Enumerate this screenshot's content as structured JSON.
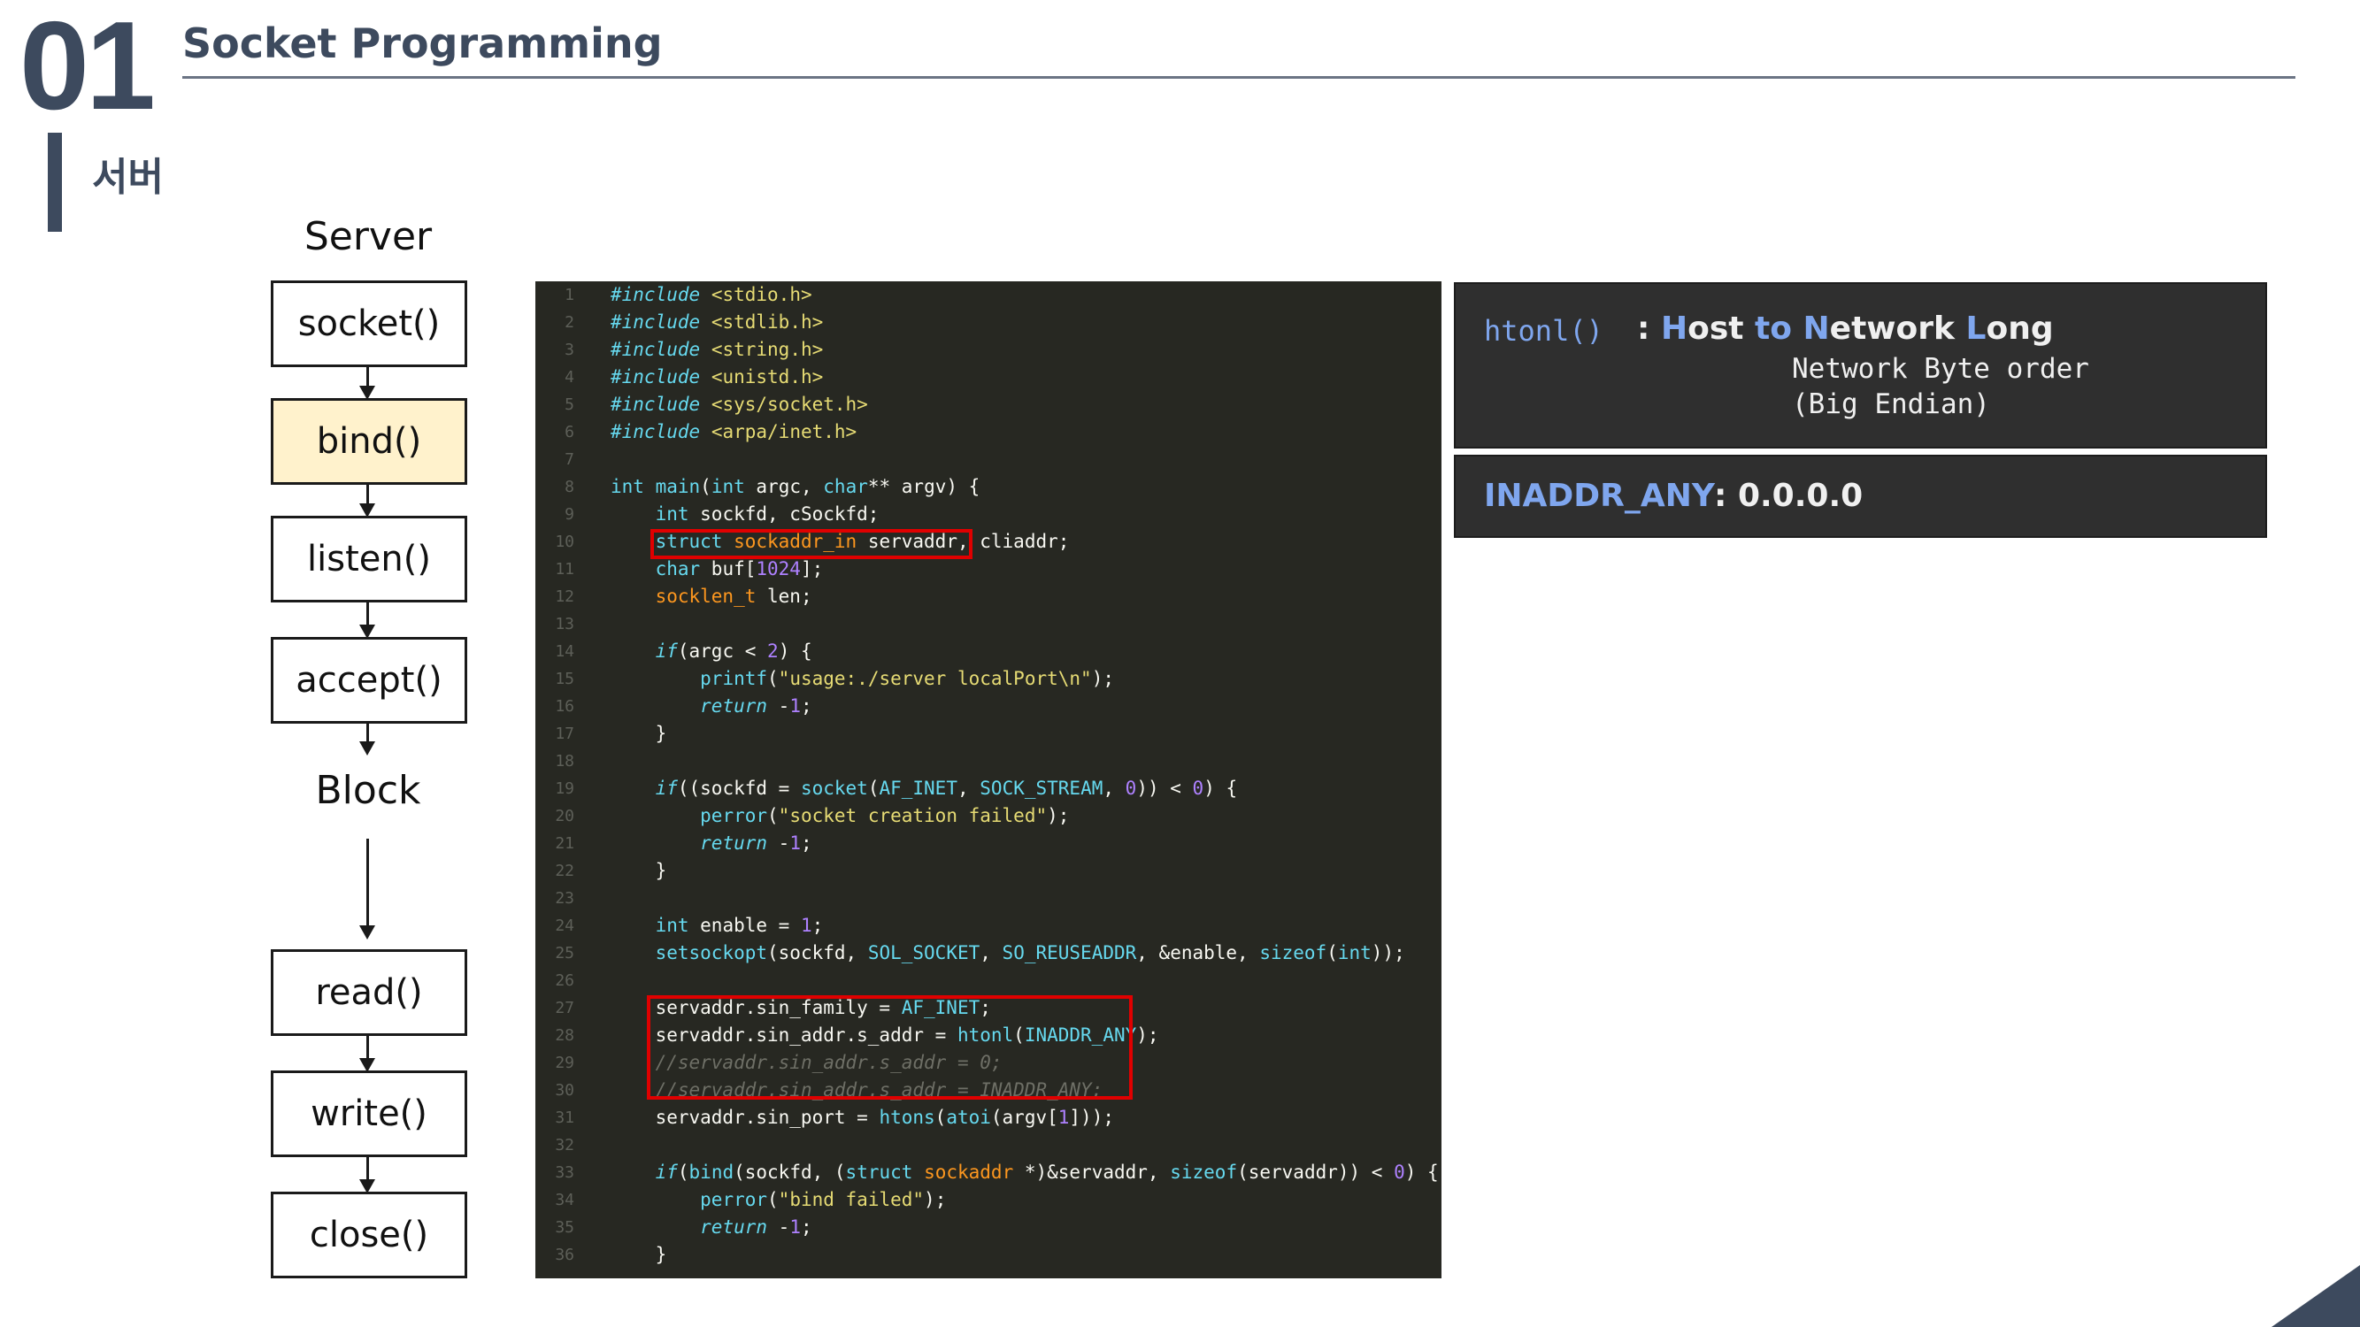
{
  "header": {
    "number": "01",
    "title": "Socket Programming",
    "subtitle": "서버"
  },
  "flow": {
    "head": "Server",
    "steps": [
      "socket()",
      "bind()",
      "listen()",
      "accept()",
      "Block",
      "read()",
      "write()",
      "close()"
    ],
    "highlight": "bind()"
  },
  "code": {
    "lines": [
      "#include <stdio.h>",
      "#include <stdlib.h>",
      "#include <string.h>",
      "#include <unistd.h>",
      "#include <sys/socket.h>",
      "#include <arpa/inet.h>",
      "",
      "int main(int argc, char** argv) {",
      "    int sockfd, cSockfd;",
      "    struct sockaddr_in servaddr, cliaddr;",
      "    char buf[1024];",
      "    socklen_t len;",
      "",
      "    if(argc < 2) {",
      "        printf(\"usage:./server localPort\\n\");",
      "        return -1;",
      "    }",
      "",
      "    if((sockfd = socket(AF_INET, SOCK_STREAM, 0)) < 0) {",
      "        perror(\"socket creation failed\");",
      "        return -1;",
      "    }",
      "",
      "    int enable = 1;",
      "    setsockopt(sockfd, SOL_SOCKET, SO_REUSEADDR, &enable, sizeof(int));",
      "",
      "    servaddr.sin_family = AF_INET;",
      "    servaddr.sin_addr.s_addr = htonl(INADDR_ANY);",
      "    //servaddr.sin_addr.s_addr = 0;",
      "    //servaddr.sin_addr.s_addr = INADDR_ANY;",
      "    servaddr.sin_port = htons(atoi(argv[1]));",
      "",
      "    if(bind(sockfd, (struct sockaddr *)&servaddr, sizeof(servaddr)) < 0) {",
      "        perror(\"bind failed\");",
      "        return -1;",
      "    }"
    ]
  },
  "notes": {
    "htonl": {
      "fn": "htonl()",
      "sep": ":",
      "words": [
        {
          "cap": "H",
          "rest": "ost"
        },
        {
          "cap": "",
          "rest": "to"
        },
        {
          "cap": "N",
          "rest": "etwork"
        },
        {
          "cap": "L",
          "rest": "ong"
        }
      ],
      "line2": "Network Byte order",
      "line3": "(Big Endian)"
    },
    "inaddr": {
      "name": "INADDR_ANY",
      "sep": ":",
      "value": "0.0.0.0"
    }
  },
  "colors": {
    "accent": "#3d4a5e",
    "highlight_box": "#fff2cc",
    "code_bg": "#272822",
    "panel_bg": "#2f2f2f",
    "red_box": "#e00000",
    "note_blue": "#7fa6ee"
  }
}
